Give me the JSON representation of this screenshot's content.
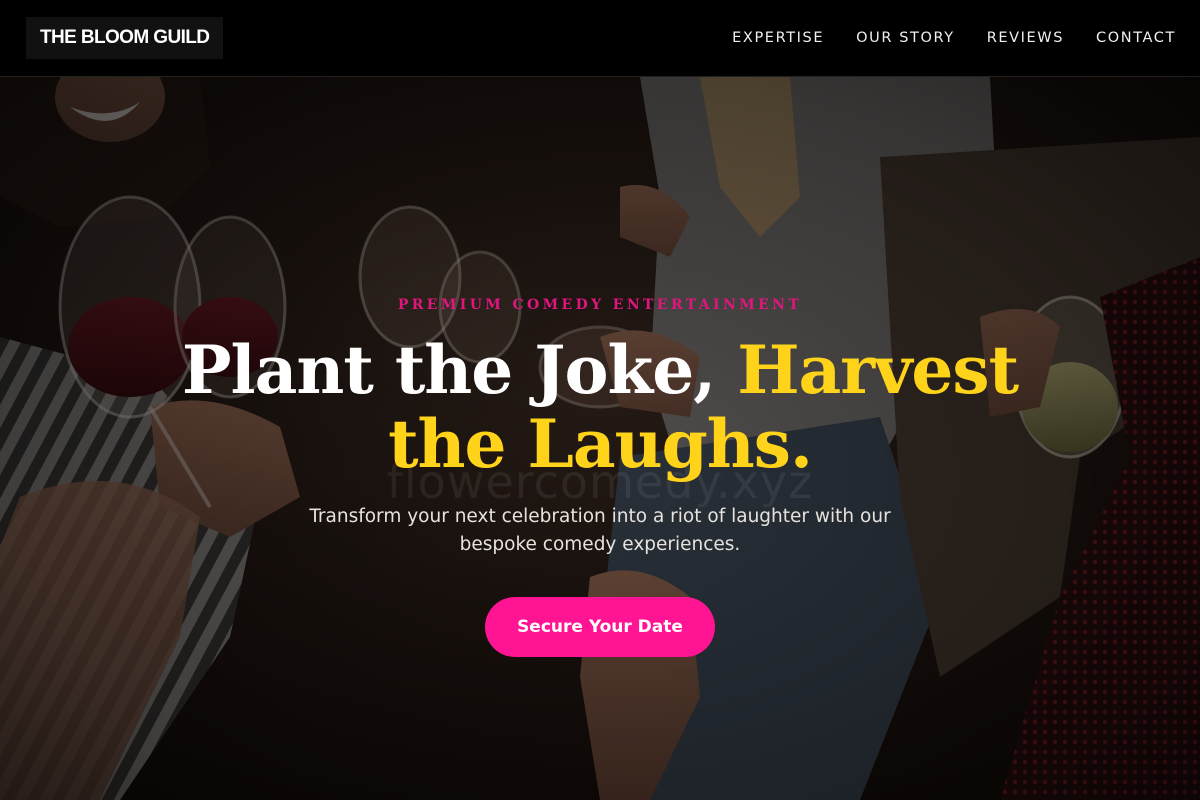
{
  "brand": {
    "name": "THE BLOOM GUILD"
  },
  "nav": {
    "items": [
      "EXPERTISE",
      "OUR STORY",
      "REVIEWS",
      "CONTACT"
    ]
  },
  "hero": {
    "eyebrow": "PREMIUM COMEDY ENTERTAINMENT",
    "headline_white": "Plant the Joke, ",
    "headline_accent": "Harvest the Laughs.",
    "subtext": "Transform your next celebration into a riot of laughter with our bespoke comedy experiences.",
    "cta_label": "Secure Your Date",
    "watermark": "flowercomedy.xyz",
    "background_image": "people toasting wine glasses at a party"
  },
  "colors": {
    "accent_pink": "#ff1493",
    "accent_yellow": "#ffd31a",
    "nav_background": "#000000"
  }
}
